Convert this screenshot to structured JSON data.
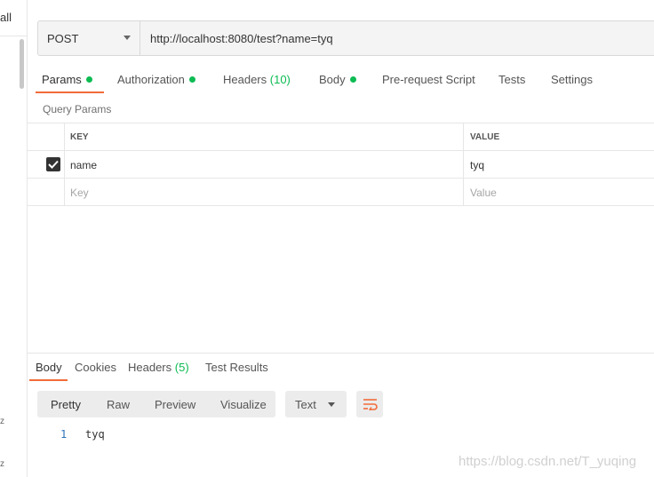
{
  "sidebar": {
    "label": "all",
    "items": [
      "z",
      "z"
    ]
  },
  "request": {
    "method": "POST",
    "url": "http://localhost:8080/test?name=tyq"
  },
  "tabs": [
    {
      "label": "Params",
      "dot": true,
      "active": true
    },
    {
      "label": "Authorization",
      "dot": true
    },
    {
      "label": "Headers",
      "count": "(10)"
    },
    {
      "label": "Body",
      "dot": true
    },
    {
      "label": "Pre-request Script"
    },
    {
      "label": "Tests"
    },
    {
      "label": "Settings"
    }
  ],
  "query_params": {
    "title": "Query Params",
    "headers": {
      "key": "KEY",
      "value": "VALUE"
    },
    "rows": [
      {
        "checked": true,
        "key": "name",
        "value": "tyq"
      }
    ],
    "placeholder": {
      "key": "Key",
      "value": "Value"
    }
  },
  "response": {
    "tabs": [
      {
        "label": "Body",
        "active": true
      },
      {
        "label": "Cookies"
      },
      {
        "label": "Headers",
        "count": "(5)"
      },
      {
        "label": "Test Results"
      }
    ],
    "formats": [
      "Pretty",
      "Raw",
      "Preview",
      "Visualize"
    ],
    "selected_format": "Pretty",
    "type": "Text",
    "lines": [
      {
        "num": "1",
        "text": "tyq"
      }
    ]
  },
  "colors": {
    "accent": "#f26b3a",
    "green": "#0cbb52",
    "line_number": "#2f73b8"
  },
  "watermark": "https://blog.csdn.net/T_yuqing"
}
